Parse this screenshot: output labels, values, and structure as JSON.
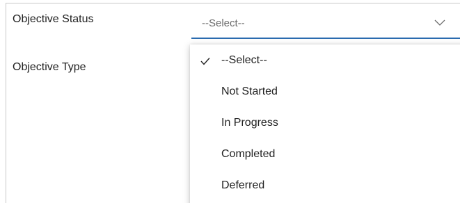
{
  "form": {
    "objective_status_label": "Objective Status",
    "objective_type_label": "Objective Type"
  },
  "status_select": {
    "value": "--Select--",
    "options": [
      {
        "label": "--Select--",
        "selected": true
      },
      {
        "label": "Not Started",
        "selected": false
      },
      {
        "label": "In Progress",
        "selected": false
      },
      {
        "label": "Completed",
        "selected": false
      },
      {
        "label": "Deferred",
        "selected": false
      }
    ]
  },
  "colors": {
    "accent_underline": "#2b6cb0",
    "placeholder_text": "#6b6b6b",
    "label_text": "#222222"
  },
  "icons": {
    "dropdown_chevron": "chevron-down-icon",
    "selected_check": "checkmark-icon"
  }
}
